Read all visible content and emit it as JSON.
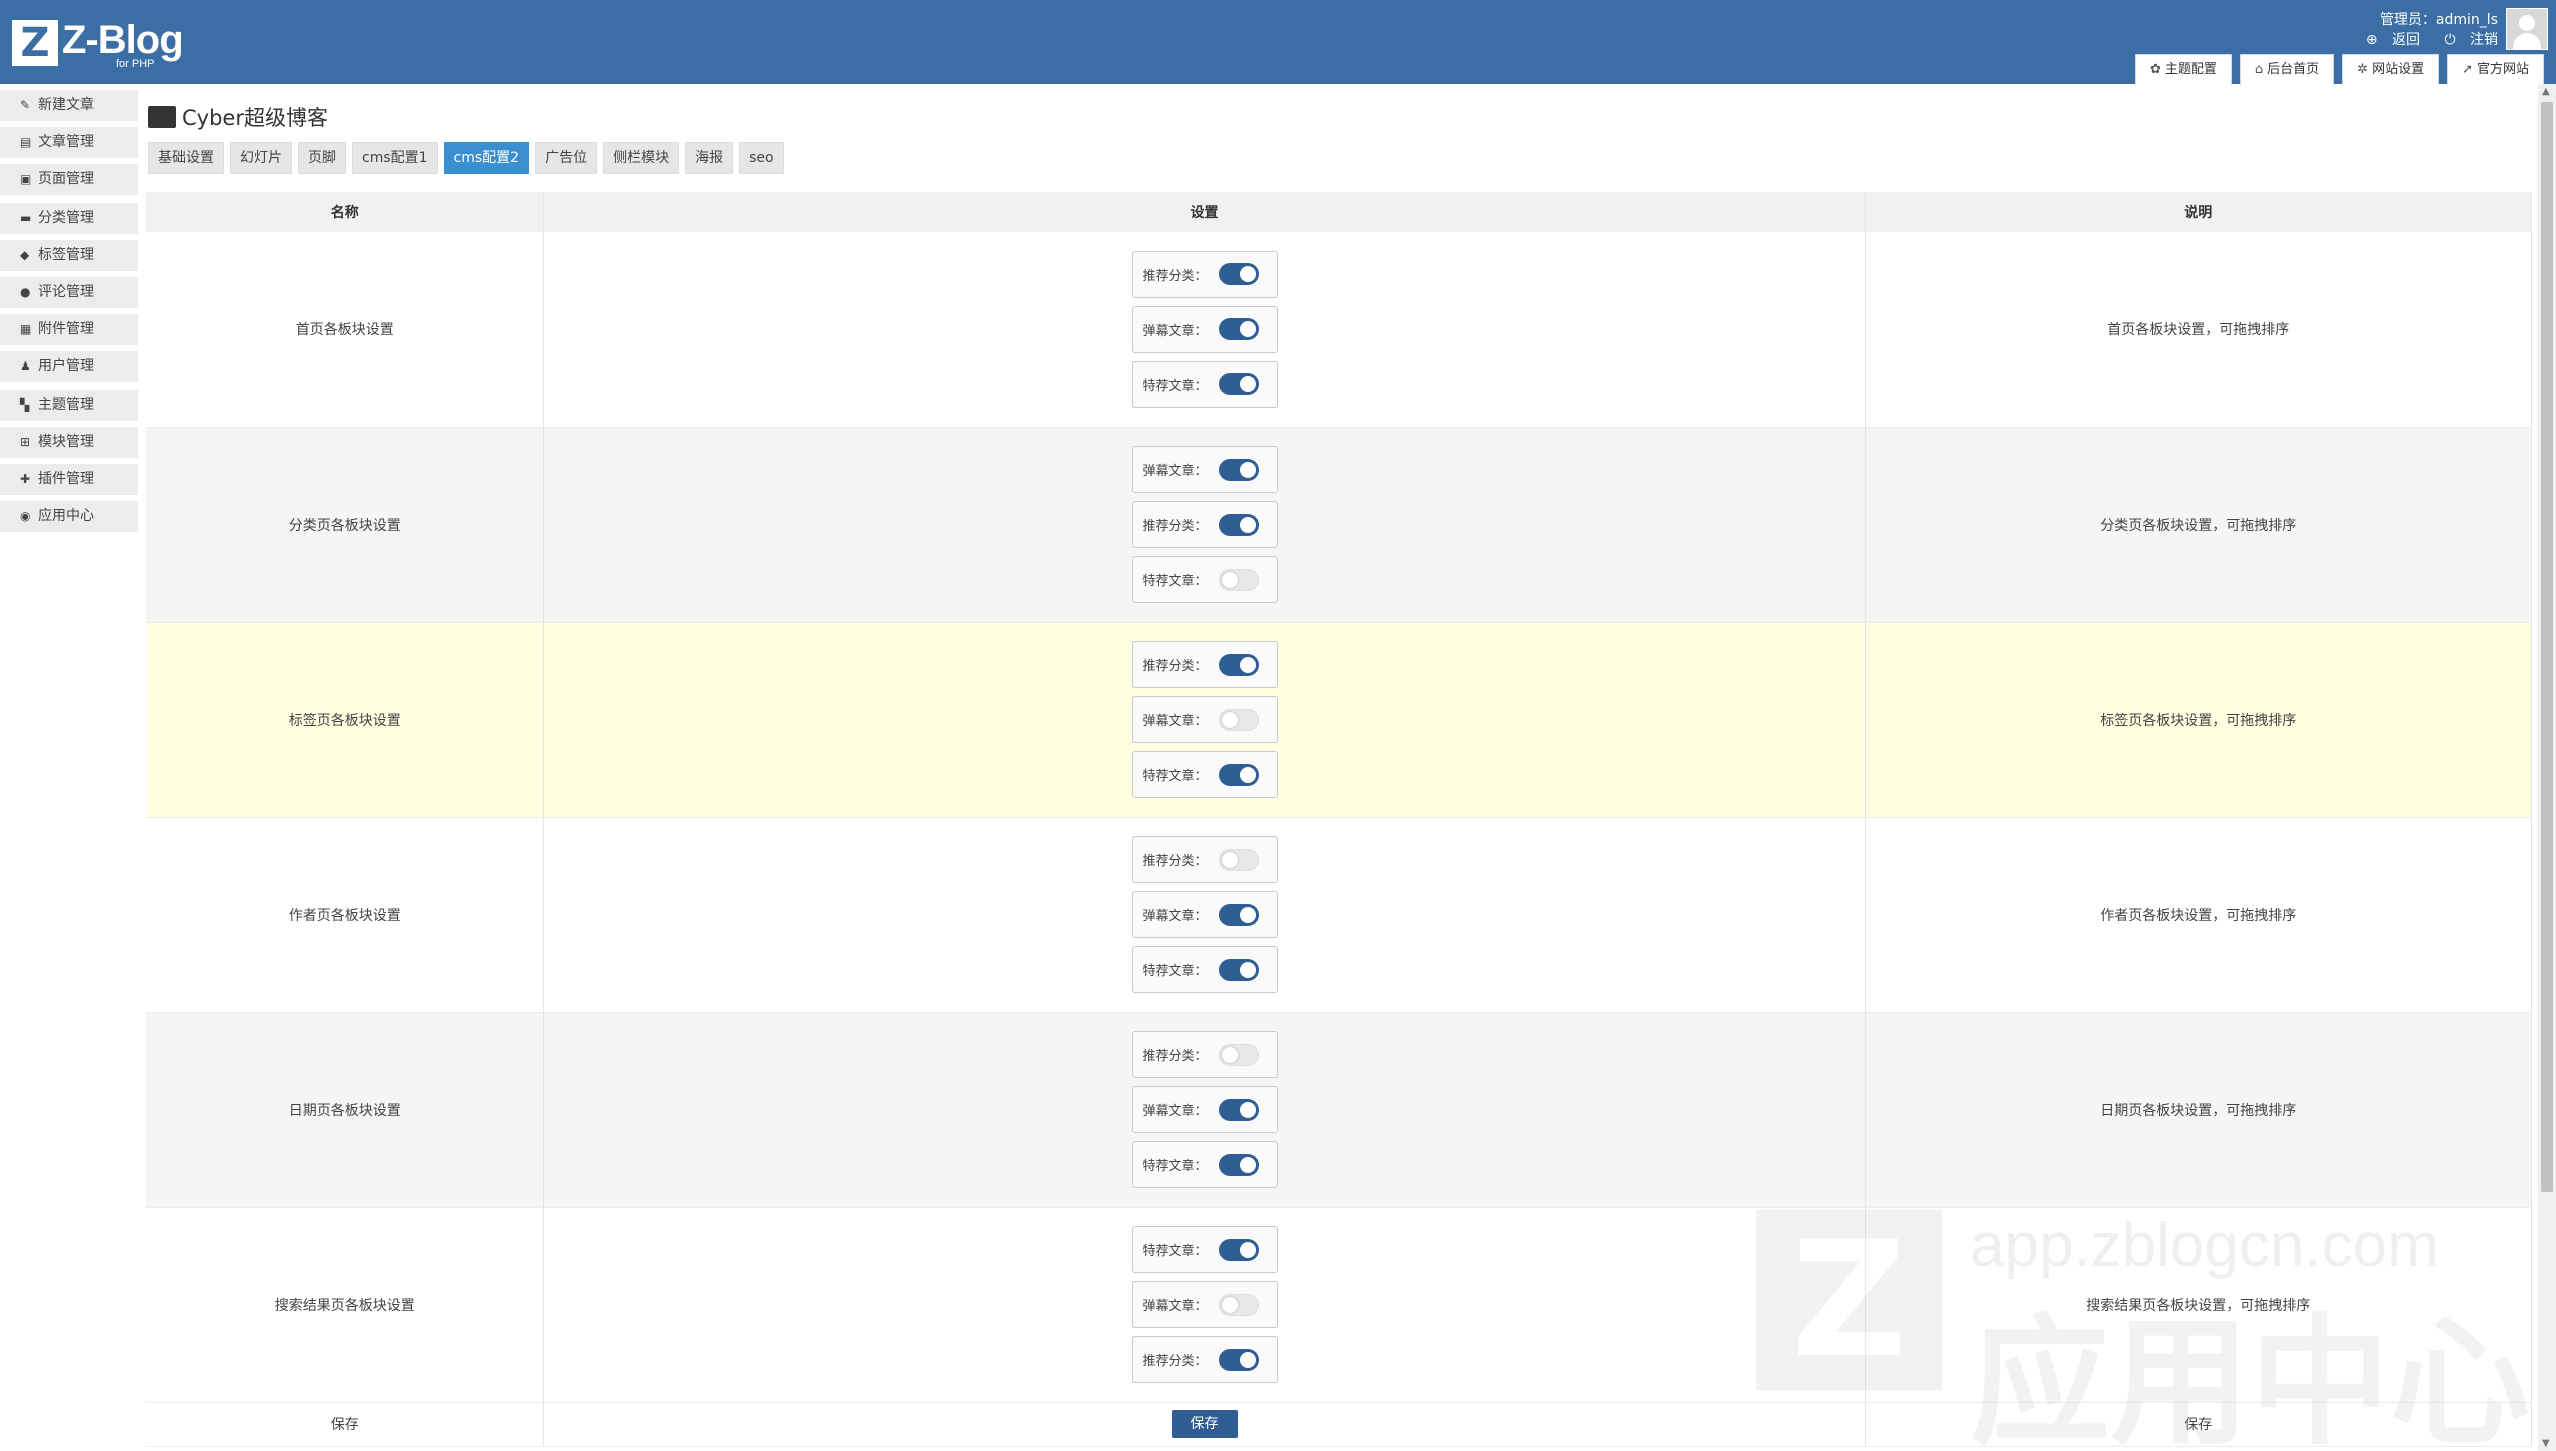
{
  "header": {
    "logo_letter": "Z",
    "logo_text": "Z-Blog",
    "logo_sub": "for PHP",
    "admin_label": "管理员：admin_ls",
    "back_label": "返回",
    "logout_label": "注销",
    "buttons": [
      {
        "icon": "gear-icon",
        "label": "主题配置"
      },
      {
        "icon": "home-icon",
        "label": "后台首页"
      },
      {
        "icon": "settings-icon",
        "label": "网站设置"
      },
      {
        "icon": "external-icon",
        "label": "官方网站"
      }
    ]
  },
  "sidebar": {
    "items": [
      {
        "label": "新建文章",
        "icon": "edit-icon"
      },
      {
        "label": "文章管理",
        "icon": "article-icon"
      },
      {
        "label": "页面管理",
        "icon": "page-icon"
      },
      {
        "label": "分类管理",
        "icon": "folder-icon"
      },
      {
        "label": "标签管理",
        "icon": "tag-icon"
      },
      {
        "label": "评论管理",
        "icon": "comment-icon"
      },
      {
        "label": "附件管理",
        "icon": "attachment-icon"
      },
      {
        "label": "用户管理",
        "icon": "users-icon"
      },
      {
        "label": "主题管理",
        "icon": "theme-icon"
      },
      {
        "label": "模块管理",
        "icon": "grid-icon"
      },
      {
        "label": "插件管理",
        "icon": "puzzle-icon"
      },
      {
        "label": "应用中心",
        "icon": "app-icon"
      }
    ]
  },
  "main": {
    "title": "Cyber超级博客",
    "tabs": [
      "基础设置",
      "幻灯片",
      "页脚",
      "cms配置1",
      "cms配置2",
      "广告位",
      "侧栏模块",
      "海报",
      "seo"
    ],
    "active_tab": "cms配置2",
    "columns": [
      "名称",
      "设置",
      "说明"
    ],
    "rows": [
      {
        "name": "首页各板块设置",
        "desc": "首页各板块设置，可拖拽排序",
        "switches": [
          {
            "label": "推荐分类：",
            "on": true
          },
          {
            "label": "弹幕文章：",
            "on": true
          },
          {
            "label": "特荐文章：",
            "on": true
          }
        ]
      },
      {
        "name": "分类页各板块设置",
        "desc": "分类页各板块设置，可拖拽排序",
        "switches": [
          {
            "label": "弹幕文章：",
            "on": true
          },
          {
            "label": "推荐分类：",
            "on": true
          },
          {
            "label": "特荐文章：",
            "on": false
          }
        ]
      },
      {
        "name": "标签页各板块设置",
        "desc": "标签页各板块设置，可拖拽排序",
        "switches": [
          {
            "label": "推荐分类：",
            "on": true
          },
          {
            "label": "弹幕文章：",
            "on": false
          },
          {
            "label": "特荐文章：",
            "on": true
          }
        ]
      },
      {
        "name": "作者页各板块设置",
        "desc": "作者页各板块设置，可拖拽排序",
        "switches": [
          {
            "label": "推荐分类：",
            "on": false
          },
          {
            "label": "弹幕文章：",
            "on": true
          },
          {
            "label": "特荐文章：",
            "on": true
          }
        ]
      },
      {
        "name": "日期页各板块设置",
        "desc": "日期页各板块设置，可拖拽排序",
        "switches": [
          {
            "label": "推荐分类：",
            "on": false
          },
          {
            "label": "弹幕文章：",
            "on": true
          },
          {
            "label": "特荐文章：",
            "on": true
          }
        ]
      },
      {
        "name": "搜索结果页各板块设置",
        "desc": "搜索结果页各板块设置，可拖拽排序",
        "switches": [
          {
            "label": "特荐文章：",
            "on": true
          },
          {
            "label": "弹幕文章：",
            "on": false
          },
          {
            "label": "推荐分类：",
            "on": true
          }
        ]
      }
    ],
    "save_row": {
      "name": "保存",
      "button": "保存",
      "desc": "保存"
    }
  },
  "watermark": {
    "url": "app.zblogcn.com",
    "letter": "Z",
    "text": "应用中心"
  }
}
